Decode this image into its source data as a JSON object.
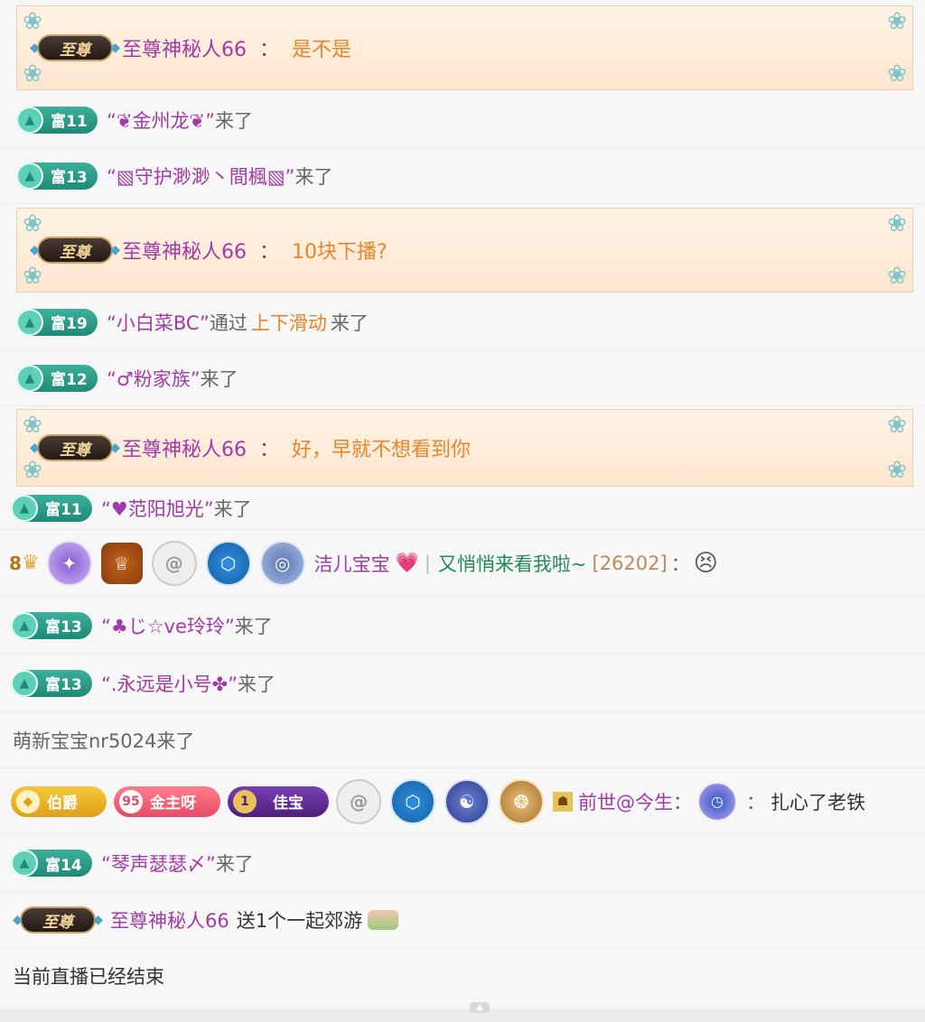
{
  "badges": {
    "zhizun": "至尊",
    "fu11": "富11",
    "fu12": "富12",
    "fu13": "富13",
    "fu14": "富14",
    "fu19": "富19",
    "bojue": "伯爵",
    "level_95": "95",
    "jinzhuya": "金主呀",
    "jiabao": "佳宝",
    "level_8": "8"
  },
  "colon": "：",
  "came": "来了",
  "messages": [
    {
      "name": "至尊神秘人66",
      "text": "是不是"
    },
    {
      "name": "“❦金州龙❦”"
    },
    {
      "name": "“▧守护渺渺丶間楓▧”"
    },
    {
      "name": "至尊神秘人66",
      "text": "10块下播?"
    },
    {
      "name": "“小白菜BC”",
      "via_prefix": "通过",
      "via": "上下滑动"
    },
    {
      "name": "“♂粉家族”"
    },
    {
      "name": "至尊神秘人66",
      "text": "好，早就不想看到你"
    },
    {
      "name": "“♥范阳旭光”"
    },
    {
      "name": "洁儿宝宝",
      "heart": "💗",
      "sep": "|",
      "text": "又悄悄来看我啦~",
      "bracket": "[26202]",
      "emoji": "😣"
    },
    {
      "name": "“♣じ☆ve玲玲”"
    },
    {
      "name": "“.永远是小号✤”"
    },
    {
      "text": "萌新宝宝nr5024来了"
    },
    {
      "name": "前世@今生",
      "text": "扎心了老铁"
    },
    {
      "name": "“琴声瑟瑟〆”"
    },
    {
      "name": "至尊神秘人66",
      "text": "送1个一起郊游",
      "gift_icon": "picnic-gift-icon"
    },
    {
      "text": "当前直播已经结束"
    }
  ],
  "colors": {
    "purple_name": "#a23aa8",
    "orange": "#e6862a",
    "green_badge": "#1f8a78"
  }
}
